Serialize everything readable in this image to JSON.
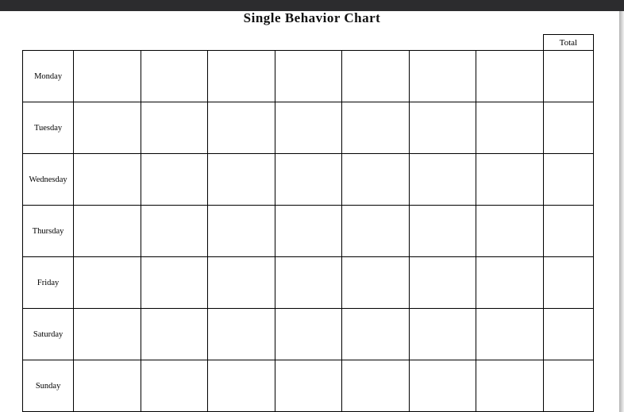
{
  "title": "Single Behavior Chart",
  "header": {
    "total": "Total"
  },
  "rows": [
    {
      "label": "Monday"
    },
    {
      "label": "Tuesday"
    },
    {
      "label": "Wednesday"
    },
    {
      "label": "Thursday"
    },
    {
      "label": "Friday"
    },
    {
      "label": "Saturday"
    },
    {
      "label": "Sunday"
    }
  ]
}
